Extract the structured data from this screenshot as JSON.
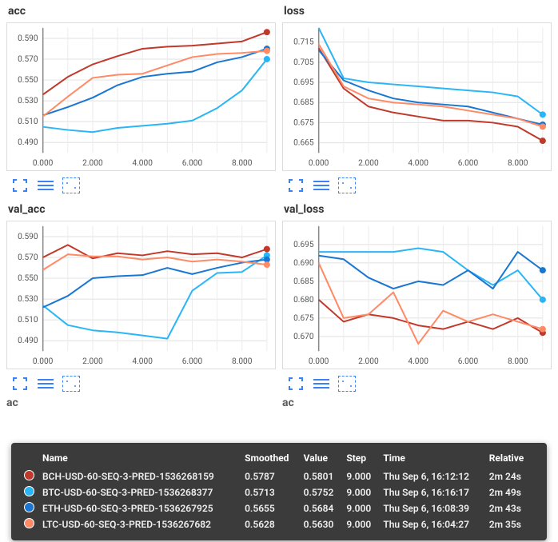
{
  "colors": {
    "BCH": "#c0392b",
    "BTC": "#29b6f6",
    "ETH": "#1976d2",
    "LTC": "#ff8a65"
  },
  "panels": [
    {
      "id": "acc",
      "title": "acc"
    },
    {
      "id": "loss",
      "title": "loss"
    },
    {
      "id": "val_acc",
      "title": "val_acc"
    },
    {
      "id": "val_loss",
      "title": "val_loss"
    }
  ],
  "controls": {
    "expand_icon": "expand",
    "rows_icon": "rows",
    "fit_icon": "fit"
  },
  "x_ticks": [
    "0.000",
    "2.000",
    "4.000",
    "6.000",
    "8.000"
  ],
  "chart_data": [
    {
      "id": "acc",
      "type": "line",
      "title": "acc",
      "x": [
        0,
        1,
        2,
        3,
        4,
        5,
        6,
        7,
        8,
        9
      ],
      "y_ticks": [
        0.49,
        0.51,
        0.53,
        0.55,
        0.57,
        0.59
      ],
      "ylim": [
        0.48,
        0.6
      ],
      "series": [
        {
          "name": "BCH-USD-60-SEQ-3-PRED-1536268159",
          "color": "#c0392b",
          "values": [
            0.536,
            0.553,
            0.565,
            0.573,
            0.58,
            0.582,
            0.583,
            0.585,
            0.587,
            0.596
          ]
        },
        {
          "name": "BTC-USD-60-SEQ-3-PRED-1536268377",
          "color": "#29b6f6",
          "values": [
            0.505,
            0.502,
            0.5,
            0.504,
            0.506,
            0.508,
            0.511,
            0.523,
            0.54,
            0.57
          ]
        },
        {
          "name": "ETH-USD-60-SEQ-3-PRED-1536267925",
          "color": "#1976d2",
          "values": [
            0.516,
            0.524,
            0.533,
            0.545,
            0.553,
            0.556,
            0.558,
            0.567,
            0.572,
            0.58
          ]
        },
        {
          "name": "LTC-USD-60-SEQ-3-PRED-1536267682",
          "color": "#ff8a65",
          "values": [
            0.515,
            0.534,
            0.552,
            0.555,
            0.556,
            0.564,
            0.572,
            0.575,
            0.576,
            0.578
          ]
        }
      ]
    },
    {
      "id": "loss",
      "type": "line",
      "title": "loss",
      "x": [
        0,
        1,
        2,
        3,
        4,
        5,
        6,
        7,
        8,
        9
      ],
      "y_ticks": [
        0.665,
        0.675,
        0.685,
        0.695,
        0.705,
        0.715
      ],
      "ylim": [
        0.66,
        0.722
      ],
      "series": [
        {
          "name": "BCH-USD",
          "color": "#c0392b",
          "values": [
            0.712,
            0.692,
            0.683,
            0.68,
            0.678,
            0.676,
            0.676,
            0.675,
            0.673,
            0.666
          ]
        },
        {
          "name": "BTC-USD",
          "color": "#29b6f6",
          "values": [
            0.722,
            0.697,
            0.695,
            0.694,
            0.693,
            0.692,
            0.691,
            0.69,
            0.688,
            0.679
          ]
        },
        {
          "name": "ETH-USD",
          "color": "#1976d2",
          "values": [
            0.711,
            0.696,
            0.691,
            0.687,
            0.685,
            0.684,
            0.683,
            0.68,
            0.677,
            0.674
          ]
        },
        {
          "name": "LTC-USD",
          "color": "#ff8a65",
          "values": [
            0.714,
            0.693,
            0.687,
            0.685,
            0.684,
            0.683,
            0.681,
            0.679,
            0.677,
            0.673
          ]
        }
      ]
    },
    {
      "id": "val_acc",
      "type": "line",
      "title": "val_acc",
      "x": [
        0,
        1,
        2,
        3,
        4,
        5,
        6,
        7,
        8,
        9
      ],
      "y_ticks": [
        0.49,
        0.51,
        0.53,
        0.55,
        0.57,
        0.59
      ],
      "ylim": [
        0.48,
        0.6
      ],
      "series": [
        {
          "name": "BCH-USD",
          "color": "#c0392b",
          "values": [
            0.57,
            0.582,
            0.569,
            0.574,
            0.572,
            0.576,
            0.573,
            0.574,
            0.57,
            0.578
          ]
        },
        {
          "name": "BTC-USD",
          "color": "#29b6f6",
          "values": [
            0.524,
            0.505,
            0.5,
            0.498,
            0.495,
            0.492,
            0.538,
            0.555,
            0.556,
            0.572
          ]
        },
        {
          "name": "ETH-USD",
          "color": "#1976d2",
          "values": [
            0.522,
            0.533,
            0.55,
            0.552,
            0.553,
            0.56,
            0.554,
            0.56,
            0.565,
            0.568
          ]
        },
        {
          "name": "LTC-USD",
          "color": "#ff8a65",
          "values": [
            0.558,
            0.573,
            0.571,
            0.571,
            0.568,
            0.57,
            0.566,
            0.568,
            0.566,
            0.563
          ]
        }
      ]
    },
    {
      "id": "val_loss",
      "type": "line",
      "title": "val_loss",
      "x": [
        0,
        1,
        2,
        3,
        4,
        5,
        6,
        7,
        8,
        9
      ],
      "y_ticks": [
        0.67,
        0.675,
        0.68,
        0.685,
        0.69,
        0.695
      ],
      "ylim": [
        0.666,
        0.7
      ],
      "series": [
        {
          "name": "BCH-USD",
          "color": "#c0392b",
          "values": [
            0.68,
            0.674,
            0.676,
            0.675,
            0.673,
            0.672,
            0.674,
            0.672,
            0.675,
            0.671
          ]
        },
        {
          "name": "BTC-USD",
          "color": "#29b6f6",
          "values": [
            0.693,
            0.693,
            0.693,
            0.693,
            0.694,
            0.693,
            0.688,
            0.684,
            0.688,
            0.68
          ]
        },
        {
          "name": "ETH-USD",
          "color": "#1976d2",
          "values": [
            0.692,
            0.691,
            0.686,
            0.683,
            0.685,
            0.684,
            0.688,
            0.683,
            0.693,
            0.688
          ]
        },
        {
          "name": "LTC-USD",
          "color": "#ff8a65",
          "values": [
            0.69,
            0.675,
            0.676,
            0.682,
            0.668,
            0.677,
            0.674,
            0.676,
            0.674,
            0.672
          ]
        }
      ]
    }
  ],
  "tooltip": {
    "headers": [
      "",
      "Name",
      "Smoothed",
      "Value",
      "Step",
      "Time",
      "Relative"
    ],
    "rows": [
      {
        "color": "#c0392b",
        "name": "BCH-USD-60-SEQ-3-PRED-1536268159",
        "smoothed": "0.5787",
        "value": "0.5801",
        "step": "9.000",
        "time": "Thu Sep 6, 16:12:12",
        "relative": "2m 24s"
      },
      {
        "color": "#29b6f6",
        "name": "BTC-USD-60-SEQ-3-PRED-1536268377",
        "smoothed": "0.5713",
        "value": "0.5752",
        "step": "9.000",
        "time": "Thu Sep 6, 16:16:17",
        "relative": "2m 49s"
      },
      {
        "color": "#1976d2",
        "name": "ETH-USD-60-SEQ-3-PRED-1536267925",
        "smoothed": "0.5655",
        "value": "0.5684",
        "step": "9.000",
        "time": "Thu Sep 6, 16:08:39",
        "relative": "2m 43s"
      },
      {
        "color": "#ff8a65",
        "name": "LTC-USD-60-SEQ-3-PRED-1536267682",
        "smoothed": "0.5628",
        "value": "0.5630",
        "step": "9.000",
        "time": "Thu Sep 6, 16:04:27",
        "relative": "2m 35s"
      }
    ]
  },
  "partial": {
    "left": "ac",
    "right": "ac"
  }
}
